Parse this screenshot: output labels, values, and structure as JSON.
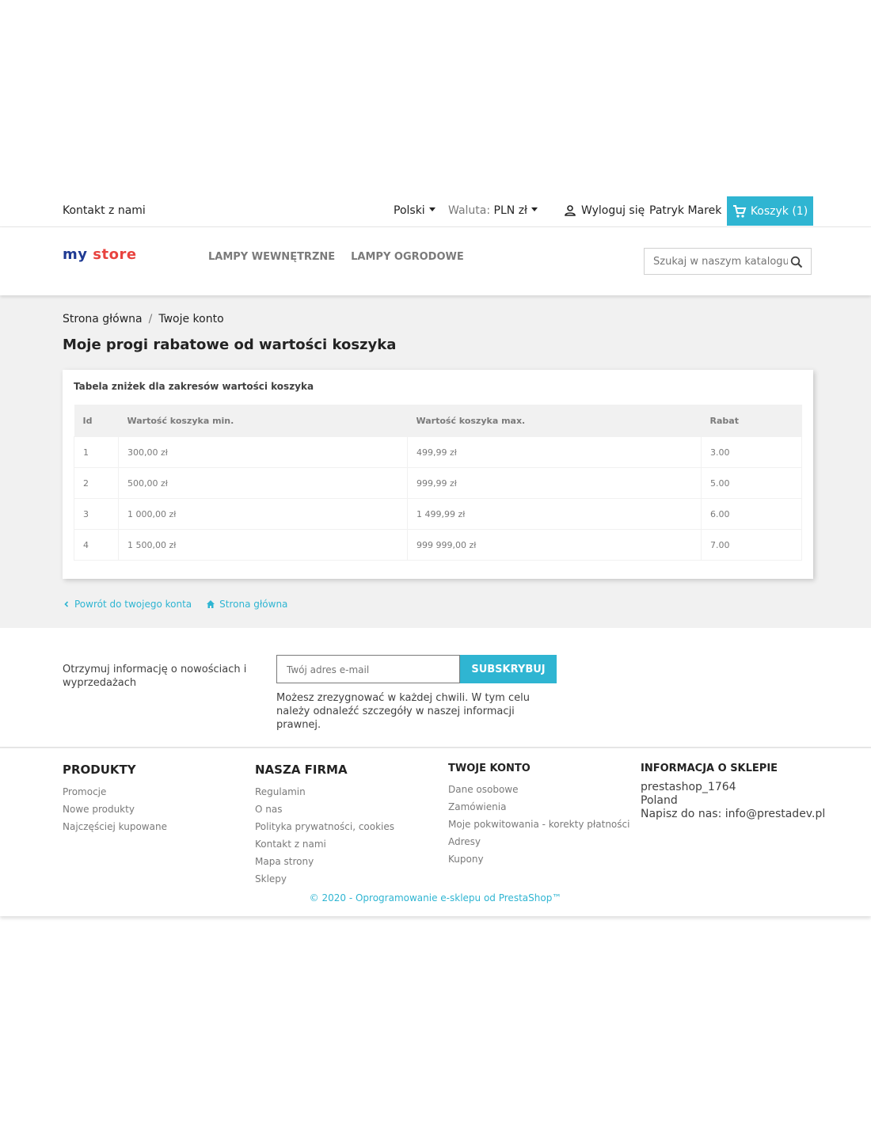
{
  "topbar": {
    "contact": "Kontakt z nami",
    "language": "Polski",
    "currency_label": "Waluta:",
    "currency_value": "PLN zł",
    "logout": "Wyloguj się",
    "user_name": "Patryk Marek",
    "cart": "Koszyk (1)"
  },
  "header": {
    "logo_word1": "my",
    "logo_word2": "store",
    "nav": [
      "LAMPY WEWNĘTRZNE",
      "LAMPY OGRODOWE"
    ],
    "search_placeholder": "Szukaj w naszym katalogu"
  },
  "breadcrumb": [
    "Strona główna",
    "Twoje konto"
  ],
  "page_title": "Moje progi rabatowe od wartości koszyka",
  "table": {
    "title": "Tabela zniżek dla zakresów wartości koszyka",
    "headers": [
      "Id",
      "Wartość koszyka min.",
      "Wartość koszyka max.",
      "Rabat"
    ],
    "rows": [
      [
        "1",
        "300,00 zł",
        "499,99 zł",
        "3.00"
      ],
      [
        "2",
        "500,00 zł",
        "999,99 zł",
        "5.00"
      ],
      [
        "3",
        "1 000,00 zł",
        "1 499,99 zł",
        "6.00"
      ],
      [
        "4",
        "1 500,00 zł",
        "999 999,00 zł",
        "7.00"
      ]
    ]
  },
  "links": {
    "back": "Powrót do twojego konta",
    "home": "Strona główna"
  },
  "newsletter": {
    "text": "Otrzymuj informację o nowościach i wyprzedażach",
    "placeholder": "Twój adres e-mail",
    "button": "SUBSKRYBUJ",
    "legal": "Możesz zrezygnować w każdej chwili. W tym celu należy odnaleźć szczegóły w naszej informacji prawnej."
  },
  "footer": {
    "products": {
      "title": "PRODUKTY",
      "items": [
        "Promocje",
        "Nowe produkty",
        "Najczęściej kupowane"
      ]
    },
    "company": {
      "title": "NASZA FIRMA",
      "items": [
        "Regulamin",
        "O nas",
        "Polityka prywatności, cookies",
        "Kontakt z nami",
        "Mapa strony",
        "Sklepy"
      ]
    },
    "account": {
      "title": "TWOJE KONTO",
      "items": [
        "Dane osobowe",
        "Zamówienia",
        "Moje pokwitowania - korekty płatności",
        "Adresy",
        "Kupony"
      ]
    },
    "store_info": {
      "title": "INFORMACJA O SKLEPIE",
      "name": "prestashop_1764",
      "country": "Poland",
      "contact": "Napisz do nas: info@prestadev.pl"
    },
    "copyright": "© 2020 - Oprogramowanie e-sklepu od PrestaShop™"
  },
  "colors": {
    "accent": "#2fb5d2",
    "gray_bg": "#f1f1f1",
    "text_dark": "#232323",
    "text_muted": "#7a7a7a"
  },
  "icons": [
    "caret-down-icon",
    "user-icon",
    "cart-icon",
    "search-icon",
    "chevron-left-icon",
    "home-icon"
  ]
}
